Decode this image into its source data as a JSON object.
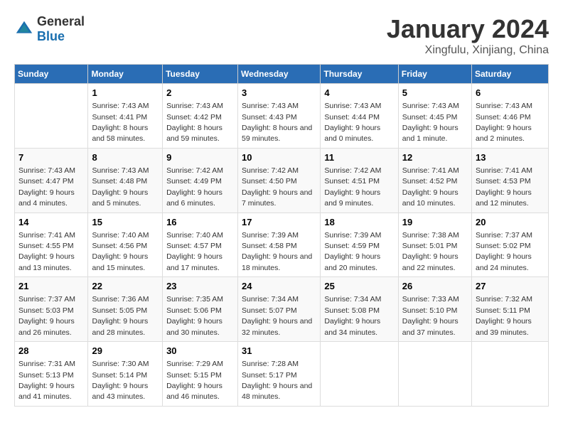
{
  "logo": {
    "general": "General",
    "blue": "Blue"
  },
  "header": {
    "title": "January 2024",
    "subtitle": "Xingfulu, Xinjiang, China"
  },
  "columns": [
    "Sunday",
    "Monday",
    "Tuesday",
    "Wednesday",
    "Thursday",
    "Friday",
    "Saturday"
  ],
  "weeks": [
    [
      {
        "day": "",
        "sunrise": "",
        "sunset": "",
        "daylight": ""
      },
      {
        "day": "1",
        "sunrise": "Sunrise: 7:43 AM",
        "sunset": "Sunset: 4:41 PM",
        "daylight": "Daylight: 8 hours and 58 minutes."
      },
      {
        "day": "2",
        "sunrise": "Sunrise: 7:43 AM",
        "sunset": "Sunset: 4:42 PM",
        "daylight": "Daylight: 8 hours and 59 minutes."
      },
      {
        "day": "3",
        "sunrise": "Sunrise: 7:43 AM",
        "sunset": "Sunset: 4:43 PM",
        "daylight": "Daylight: 8 hours and 59 minutes."
      },
      {
        "day": "4",
        "sunrise": "Sunrise: 7:43 AM",
        "sunset": "Sunset: 4:44 PM",
        "daylight": "Daylight: 9 hours and 0 minutes."
      },
      {
        "day": "5",
        "sunrise": "Sunrise: 7:43 AM",
        "sunset": "Sunset: 4:45 PM",
        "daylight": "Daylight: 9 hours and 1 minute."
      },
      {
        "day": "6",
        "sunrise": "Sunrise: 7:43 AM",
        "sunset": "Sunset: 4:46 PM",
        "daylight": "Daylight: 9 hours and 2 minutes."
      }
    ],
    [
      {
        "day": "7",
        "sunrise": "Sunrise: 7:43 AM",
        "sunset": "Sunset: 4:47 PM",
        "daylight": "Daylight: 9 hours and 4 minutes."
      },
      {
        "day": "8",
        "sunrise": "Sunrise: 7:43 AM",
        "sunset": "Sunset: 4:48 PM",
        "daylight": "Daylight: 9 hours and 5 minutes."
      },
      {
        "day": "9",
        "sunrise": "Sunrise: 7:42 AM",
        "sunset": "Sunset: 4:49 PM",
        "daylight": "Daylight: 9 hours and 6 minutes."
      },
      {
        "day": "10",
        "sunrise": "Sunrise: 7:42 AM",
        "sunset": "Sunset: 4:50 PM",
        "daylight": "Daylight: 9 hours and 7 minutes."
      },
      {
        "day": "11",
        "sunrise": "Sunrise: 7:42 AM",
        "sunset": "Sunset: 4:51 PM",
        "daylight": "Daylight: 9 hours and 9 minutes."
      },
      {
        "day": "12",
        "sunrise": "Sunrise: 7:41 AM",
        "sunset": "Sunset: 4:52 PM",
        "daylight": "Daylight: 9 hours and 10 minutes."
      },
      {
        "day": "13",
        "sunrise": "Sunrise: 7:41 AM",
        "sunset": "Sunset: 4:53 PM",
        "daylight": "Daylight: 9 hours and 12 minutes."
      }
    ],
    [
      {
        "day": "14",
        "sunrise": "Sunrise: 7:41 AM",
        "sunset": "Sunset: 4:55 PM",
        "daylight": "Daylight: 9 hours and 13 minutes."
      },
      {
        "day": "15",
        "sunrise": "Sunrise: 7:40 AM",
        "sunset": "Sunset: 4:56 PM",
        "daylight": "Daylight: 9 hours and 15 minutes."
      },
      {
        "day": "16",
        "sunrise": "Sunrise: 7:40 AM",
        "sunset": "Sunset: 4:57 PM",
        "daylight": "Daylight: 9 hours and 17 minutes."
      },
      {
        "day": "17",
        "sunrise": "Sunrise: 7:39 AM",
        "sunset": "Sunset: 4:58 PM",
        "daylight": "Daylight: 9 hours and 18 minutes."
      },
      {
        "day": "18",
        "sunrise": "Sunrise: 7:39 AM",
        "sunset": "Sunset: 4:59 PM",
        "daylight": "Daylight: 9 hours and 20 minutes."
      },
      {
        "day": "19",
        "sunrise": "Sunrise: 7:38 AM",
        "sunset": "Sunset: 5:01 PM",
        "daylight": "Daylight: 9 hours and 22 minutes."
      },
      {
        "day": "20",
        "sunrise": "Sunrise: 7:37 AM",
        "sunset": "Sunset: 5:02 PM",
        "daylight": "Daylight: 9 hours and 24 minutes."
      }
    ],
    [
      {
        "day": "21",
        "sunrise": "Sunrise: 7:37 AM",
        "sunset": "Sunset: 5:03 PM",
        "daylight": "Daylight: 9 hours and 26 minutes."
      },
      {
        "day": "22",
        "sunrise": "Sunrise: 7:36 AM",
        "sunset": "Sunset: 5:05 PM",
        "daylight": "Daylight: 9 hours and 28 minutes."
      },
      {
        "day": "23",
        "sunrise": "Sunrise: 7:35 AM",
        "sunset": "Sunset: 5:06 PM",
        "daylight": "Daylight: 9 hours and 30 minutes."
      },
      {
        "day": "24",
        "sunrise": "Sunrise: 7:34 AM",
        "sunset": "Sunset: 5:07 PM",
        "daylight": "Daylight: 9 hours and 32 minutes."
      },
      {
        "day": "25",
        "sunrise": "Sunrise: 7:34 AM",
        "sunset": "Sunset: 5:08 PM",
        "daylight": "Daylight: 9 hours and 34 minutes."
      },
      {
        "day": "26",
        "sunrise": "Sunrise: 7:33 AM",
        "sunset": "Sunset: 5:10 PM",
        "daylight": "Daylight: 9 hours and 37 minutes."
      },
      {
        "day": "27",
        "sunrise": "Sunrise: 7:32 AM",
        "sunset": "Sunset: 5:11 PM",
        "daylight": "Daylight: 9 hours and 39 minutes."
      }
    ],
    [
      {
        "day": "28",
        "sunrise": "Sunrise: 7:31 AM",
        "sunset": "Sunset: 5:13 PM",
        "daylight": "Daylight: 9 hours and 41 minutes."
      },
      {
        "day": "29",
        "sunrise": "Sunrise: 7:30 AM",
        "sunset": "Sunset: 5:14 PM",
        "daylight": "Daylight: 9 hours and 43 minutes."
      },
      {
        "day": "30",
        "sunrise": "Sunrise: 7:29 AM",
        "sunset": "Sunset: 5:15 PM",
        "daylight": "Daylight: 9 hours and 46 minutes."
      },
      {
        "day": "31",
        "sunrise": "Sunrise: 7:28 AM",
        "sunset": "Sunset: 5:17 PM",
        "daylight": "Daylight: 9 hours and 48 minutes."
      },
      {
        "day": "",
        "sunrise": "",
        "sunset": "",
        "daylight": ""
      },
      {
        "day": "",
        "sunrise": "",
        "sunset": "",
        "daylight": ""
      },
      {
        "day": "",
        "sunrise": "",
        "sunset": "",
        "daylight": ""
      }
    ]
  ]
}
